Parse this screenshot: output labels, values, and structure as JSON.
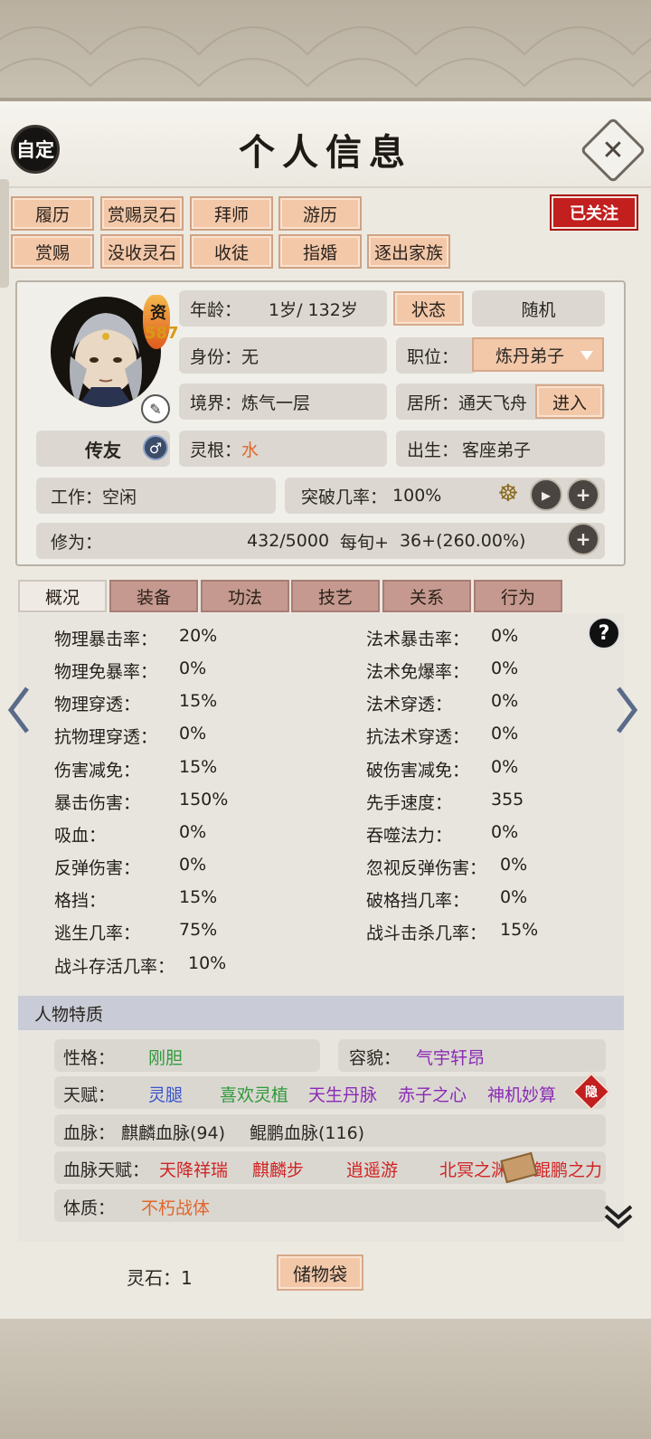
{
  "title": "个人信息",
  "header": {
    "custom_label": "自定"
  },
  "actions": {
    "row1": [
      "履历",
      "赏赐灵石",
      "拜师",
      "游历"
    ],
    "row2": [
      "赏赐",
      "没收灵石",
      "收徒",
      "指婚",
      "逐出家族"
    ],
    "followed_label": "已关注"
  },
  "character": {
    "aptitude_label": "资",
    "aptitude_value": "587",
    "chuanyou_label": "传友",
    "age_label": "年龄：",
    "age_value": "1岁/ 132岁",
    "status_button": "状态",
    "random_button": "随机",
    "identity_label": "身份：",
    "identity_value": "无",
    "position_label": "职位：",
    "position_value": "炼丹弟子",
    "realm_label": "境界：",
    "realm_value": "炼气一层",
    "residence_label": "居所：",
    "residence_value": "通天飞舟",
    "enter_button": "进入",
    "spirit_root_label": "灵根：",
    "spirit_root_value": "水",
    "birth_label": "出生：",
    "birth_value": "客座弟子",
    "work_label": "工作：",
    "work_value": "空闲",
    "breakthrough_label": "突破几率：",
    "breakthrough_value": "100%",
    "cultivation_label": "修为：",
    "cultivation_value": "432/5000",
    "per_round_label": "每旬+",
    "per_round_value": "36+(260.00%)"
  },
  "tabs": [
    "概况",
    "装备",
    "功法",
    "技艺",
    "关系",
    "行为"
  ],
  "stats_left": [
    {
      "label": "物理暴击率：",
      "value": "20%"
    },
    {
      "label": "物理免暴率：",
      "value": "0%"
    },
    {
      "label": "物理穿透：",
      "value": "15%"
    },
    {
      "label": "抗物理穿透：",
      "value": "0%"
    },
    {
      "label": "伤害减免：",
      "value": "15%"
    },
    {
      "label": "暴击伤害：",
      "value": "150%"
    },
    {
      "label": "吸血：",
      "value": "0%"
    },
    {
      "label": "反弹伤害：",
      "value": "0%"
    },
    {
      "label": "格挡：",
      "value": "15%"
    },
    {
      "label": "逃生几率：",
      "value": "75%"
    },
    {
      "label": "战斗存活几率：",
      "value": "10%"
    }
  ],
  "stats_right": [
    {
      "label": "法术暴击率：",
      "value": "0%"
    },
    {
      "label": "法术免爆率：",
      "value": "0%"
    },
    {
      "label": "法术穿透：",
      "value": "0%"
    },
    {
      "label": "抗法术穿透：",
      "value": "0%"
    },
    {
      "label": "破伤害减免：",
      "value": "0%"
    },
    {
      "label": "先手速度：",
      "value": "355"
    },
    {
      "label": "吞噬法力：",
      "value": "0%"
    },
    {
      "label": "忽视反弹伤害：",
      "value": "0%"
    },
    {
      "label": "破格挡几率：",
      "value": "0%"
    },
    {
      "label": "战斗击杀几率：",
      "value": "15%"
    }
  ],
  "traits": {
    "header": "人物特质",
    "personality_label": "性格：",
    "personality_value": "刚胆",
    "appearance_label": "容貌：",
    "appearance_value": "气宇轩昂",
    "talent_label": "天赋：",
    "talents": [
      "灵腿",
      "喜欢灵植",
      "天生丹脉",
      "赤子之心",
      "神机妙算"
    ],
    "hide_badge": "隐",
    "bloodline_label": "血脉：",
    "bloodlines": [
      "麒麟血脉(94)",
      "鲲鹏血脉(116)"
    ],
    "bloodline_talent_label": "血脉天赋：",
    "bloodline_talents": [
      "天降祥瑞",
      "麒麟步",
      "逍遥游",
      "北冥之渊",
      "鲲鹏之力"
    ],
    "physique_label": "体质：",
    "physique_value": "不朽战体"
  },
  "footer": {
    "spirit_stones_label": "灵石：1",
    "bag_button": "储物袋"
  },
  "colors": {
    "accent_orange": "#f2c8a9",
    "followed_red": "#c21f1f",
    "spirit_root_orange": "#e0662c",
    "personality_green": "#2f9a3a",
    "appearance_purple": "#8a2ab5",
    "bloodline_talent_red": "#d02424",
    "physique_orange": "#e0662c"
  }
}
